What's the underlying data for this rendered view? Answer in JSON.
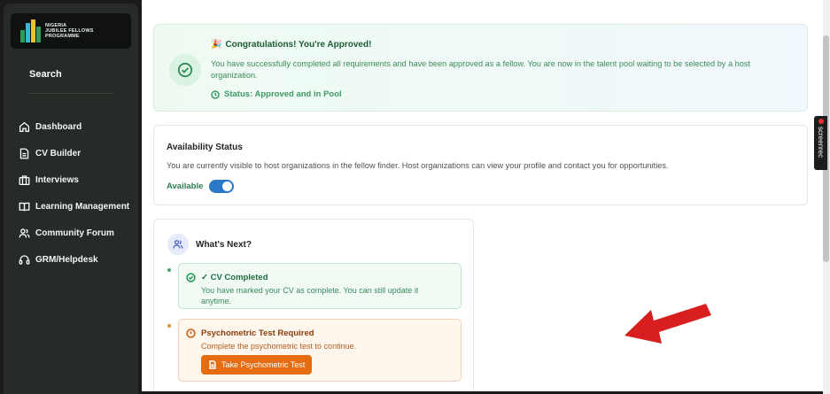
{
  "sidebar": {
    "logo": {
      "line1": "NIGERIA",
      "line2": "JUBILEE FELLOWS",
      "line3": "PROGRAMME"
    },
    "search_label": "Search",
    "items": [
      {
        "label": "Dashboard",
        "icon": "home-icon"
      },
      {
        "label": "CV Builder",
        "icon": "document-icon"
      },
      {
        "label": "Interviews",
        "icon": "briefcase-icon"
      },
      {
        "label": "Learning Management",
        "icon": "book-icon"
      },
      {
        "label": "Community Forum",
        "icon": "users-icon"
      },
      {
        "label": "GRM/Helpdesk",
        "icon": "headset-icon"
      }
    ]
  },
  "approval": {
    "icon": "check-circle-icon",
    "emoji": "🎉",
    "title": "Congratulations! You're Approved!",
    "message": "You have successfully completed all requirements and have been approved as a fellow. You are now in the talent pool waiting to be selected by a host organization.",
    "status": "Status: Approved and in Pool"
  },
  "availability": {
    "title": "Availability Status",
    "description": "You are currently visible to host organizations in the fellow finder. Host organizations can view your profile and contact you for opportunities.",
    "toggle_label": "Available",
    "toggle_on": true
  },
  "whats_next": {
    "title": "What's Next?",
    "steps": [
      {
        "status": "done",
        "title": "✓ CV Completed",
        "description": "You have marked your CV as complete. You can still update it anytime."
      },
      {
        "status": "todo",
        "title": "Psychometric Test Required",
        "description": "Complete the psychometric test to continue.",
        "button_label": "Take Psychometric Test"
      }
    ]
  },
  "overlay": {
    "recorder_label": "screenrec"
  },
  "colors": {
    "sidebar_bg": "#262b27",
    "accent_green": "#3f9a66",
    "toggle_blue": "#2a78c8",
    "action_orange": "#e56d10",
    "annotation_red": "#d81e1e"
  }
}
